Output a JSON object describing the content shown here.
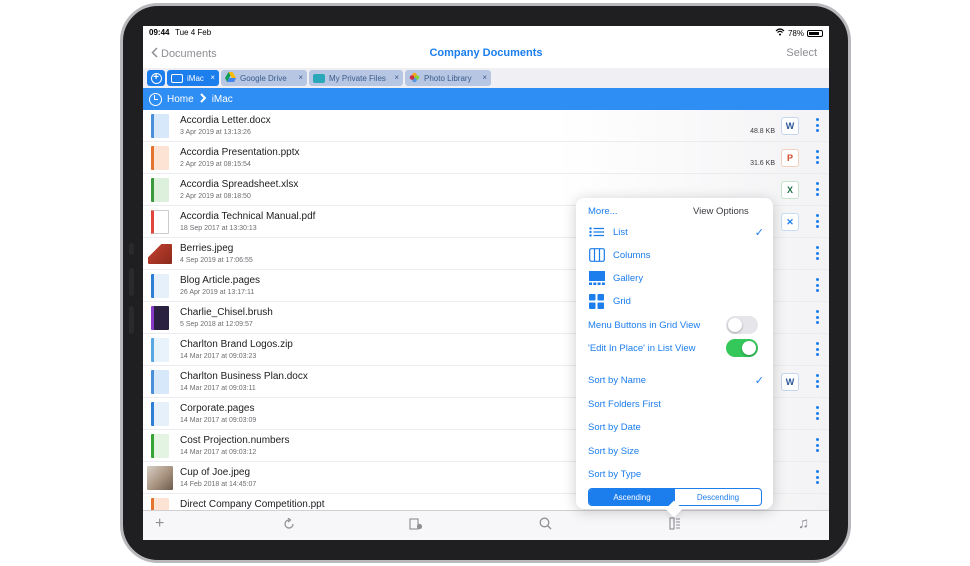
{
  "status": {
    "time": "09:44",
    "date": "Tue 4 Feb",
    "battery": "78%"
  },
  "nav": {
    "back_label": "Documents",
    "title": "Company Documents",
    "select_label": "Select"
  },
  "tabs": [
    {
      "label": "iMac",
      "close": "×"
    },
    {
      "label": "Google Drive",
      "close": "×"
    },
    {
      "label": "My Private Files",
      "close": "×"
    },
    {
      "label": "Photo Library",
      "close": "×"
    }
  ],
  "path": {
    "home": "Home",
    "current": "iMac"
  },
  "files": [
    {
      "name": "Accordia Letter.docx",
      "date": "3 Apr 2019 at 13:13:26",
      "size": "48.8 KB",
      "icon": "W"
    },
    {
      "name": "Accordia Presentation.pptx",
      "date": "2 Apr 2019 at 08:15:54",
      "size": "31.6 KB",
      "icon": "P"
    },
    {
      "name": "Accordia Spreadsheet.xlsx",
      "date": "2 Apr 2019 at 08:18:50",
      "size": "",
      "icon": "X"
    },
    {
      "name": "Accordia Technical Manual.pdf",
      "date": "18 Sep 2017 at 13:30:13",
      "size": "",
      "icon": "✕"
    },
    {
      "name": "Berries.jpeg",
      "date": "4 Sep 2019 at 17:06:55",
      "size": "",
      "icon": ""
    },
    {
      "name": "Blog Article.pages",
      "date": "26 Apr 2019 at 13:17:11",
      "size": "",
      "icon": ""
    },
    {
      "name": "Charlie_Chisel.brush",
      "date": "5 Sep 2018 at 12:09:57",
      "size": "",
      "icon": ""
    },
    {
      "name": "Charlton Brand Logos.zip",
      "date": "14 Mar 2017 at 09:03:23",
      "size": "",
      "icon": ""
    },
    {
      "name": "Charlton Business Plan.docx",
      "date": "14 Mar 2017 at 09:03:11",
      "size": "",
      "icon": "W"
    },
    {
      "name": "Corporate.pages",
      "date": "14 Mar 2017 at 09:03:09",
      "size": "",
      "icon": ""
    },
    {
      "name": "Cost Projection.numbers",
      "date": "14 Mar 2017 at 09:03:12",
      "size": "",
      "icon": ""
    },
    {
      "name": "Cup of Joe.jpeg",
      "date": "14 Feb 2018 at 14:45:07",
      "size": "",
      "icon": ""
    },
    {
      "name": "Direct Company Competition.ppt",
      "date": "",
      "size": "",
      "icon": ""
    }
  ],
  "popover": {
    "more": "More...",
    "title": "View Options",
    "views": [
      "List",
      "Columns",
      "Gallery",
      "Grid"
    ],
    "toggles": [
      "Menu Buttons in Grid View",
      "'Edit In Place' in List View"
    ],
    "sorts": [
      "Sort by Name",
      "Sort Folders First",
      "Sort by Date",
      "Sort by Size",
      "Sort by Type"
    ],
    "order": [
      "Ascending",
      "Descending"
    ],
    "check": "✓"
  },
  "toolbar": {
    "add": "+",
    "music": "♫"
  },
  "colors": {
    "accent": "#1c7ded",
    "path_bar": "#2f8ef4",
    "toggle_on": "#34c759"
  }
}
